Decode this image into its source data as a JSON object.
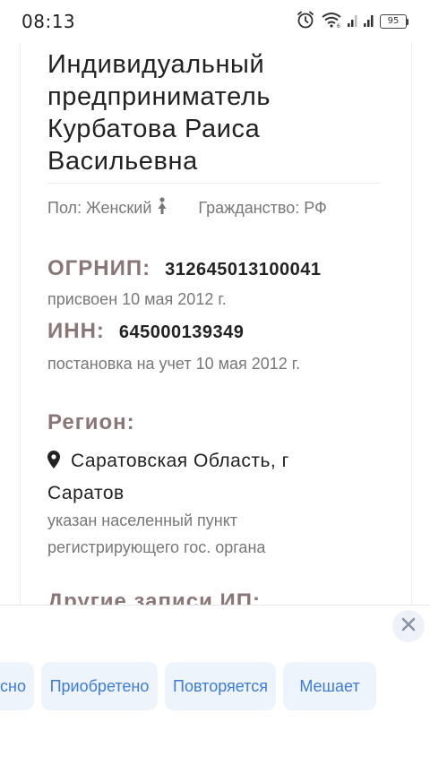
{
  "status_bar": {
    "time": "08:13",
    "battery": "95",
    "icons": [
      "alarm-icon",
      "wifi-icon",
      "signal-icon",
      "signal-icon",
      "battery-icon"
    ]
  },
  "entity": {
    "title": "Индивидуальный предприниматель Курбатова Раиса Васильевна",
    "gender": "Пол: Женский",
    "citizenship": "Гражданство: РФ"
  },
  "ogrnip": {
    "label": "ОГРНИП:",
    "value": "312645013100041",
    "sub": "присвоен 10 мая 2012 г."
  },
  "inn": {
    "label": "ИНН:",
    "value": "645000139349",
    "sub": "постановка на учет 10 мая 2012 г."
  },
  "region": {
    "label": "Регион:",
    "value": "Саратовская Область, г Саратов",
    "sub": "указан населенный пункт регистрирующего гос. органа"
  },
  "other_records": {
    "label": "Другие записи ИП:"
  },
  "feedback_panel": {
    "chips": [
      "сно",
      "Приобретено",
      "Повторяется",
      "Мешает"
    ],
    "accent_color": "#3d7bd8",
    "chip_bg": "#eef4fb"
  }
}
